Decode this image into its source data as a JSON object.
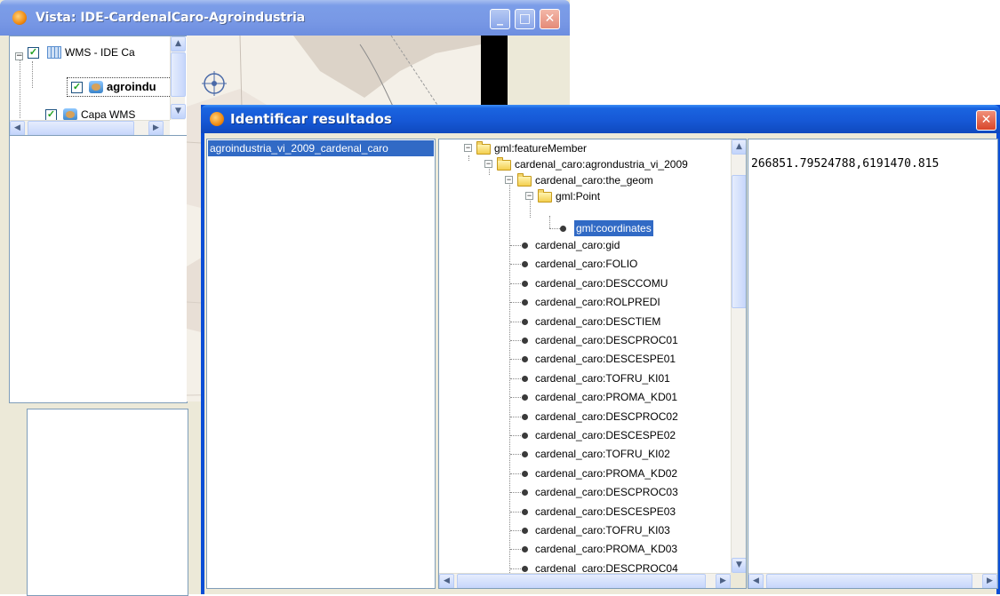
{
  "vista": {
    "title": "Vista: IDE-CardenalCaro-Agroindustria",
    "toc": [
      {
        "label": "WMS - IDE Ca",
        "checked": true,
        "icon": "wms-grid-icon"
      },
      {
        "label": "agroindu",
        "checked": true,
        "icon": "wms-layer-icon"
      },
      {
        "label": "Capa WMS",
        "checked": true,
        "icon": "wms-layer-icon"
      }
    ]
  },
  "dialog": {
    "title": "Identificar resultados",
    "layers": [
      "agroindustria_vi_2009_cardenal_caro"
    ],
    "tree": {
      "root": "gml:featureMember",
      "feature": "cardenal_caro:agrondustria_vi_2009",
      "geom": "cardenal_caro:the_geom",
      "point": "gml:Point",
      "coordinates": "gml:coordinates",
      "attributes": [
        "cardenal_caro:gid",
        "cardenal_caro:FOLIO",
        "cardenal_caro:DESCCOMU",
        "cardenal_caro:ROLPREDI",
        "cardenal_caro:DESCTIEM",
        "cardenal_caro:DESCPROC01",
        "cardenal_caro:DESCESPE01",
        "cardenal_caro:TOFRU_KI01",
        "cardenal_caro:PROMA_KD01",
        "cardenal_caro:DESCPROC02",
        "cardenal_caro:DESCESPE02",
        "cardenal_caro:TOFRU_KI02",
        "cardenal_caro:PROMA_KD02",
        "cardenal_caro:DESCPROC03",
        "cardenal_caro:DESCESPE03",
        "cardenal_caro:TOFRU_KI03",
        "cardenal_caro:PROMA_KD03",
        "cardenal_caro:DESCPROC04"
      ]
    },
    "value": "266851.79524788,6191470.815"
  },
  "colors": {
    "titlebar": "#0a4ed6",
    "selection": "#316ac5",
    "window_bg": "#ece9d8",
    "close_button": "#d8452a"
  },
  "icons": {
    "minimize": "_",
    "maximize": "□",
    "close": "✕",
    "check": "✓",
    "arrow_up": "▲",
    "arrow_down": "▼",
    "arrow_left": "◀",
    "arrow_right": "▶",
    "tree_minus": "−"
  }
}
